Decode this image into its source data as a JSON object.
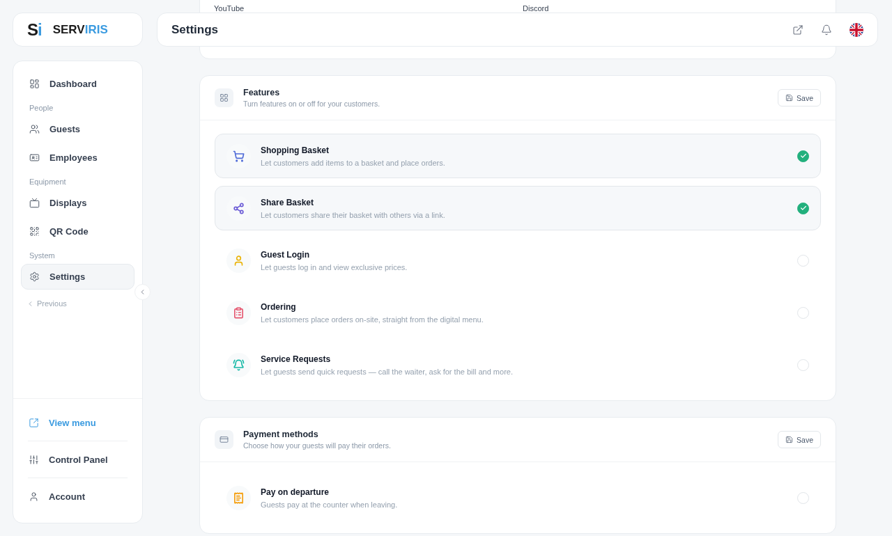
{
  "brand": {
    "mark_dark": "S",
    "mark_light": "i",
    "name_dark": "SERV",
    "name_light": "IRIS"
  },
  "header": {
    "title": "Settings"
  },
  "top_card": {
    "labels": [
      "YouTube",
      "Discord"
    ]
  },
  "sidebar": {
    "items": [
      {
        "kind": "item",
        "label": "Dashboard",
        "selected": false
      },
      {
        "kind": "section",
        "label": "People"
      },
      {
        "kind": "item",
        "label": "Guests",
        "selected": false
      },
      {
        "kind": "item",
        "label": "Employees",
        "selected": false
      },
      {
        "kind": "section",
        "label": "Equipment"
      },
      {
        "kind": "item",
        "label": "Displays",
        "selected": false
      },
      {
        "kind": "item",
        "label": "QR Code",
        "selected": false
      },
      {
        "kind": "section",
        "label": "System"
      },
      {
        "kind": "item",
        "label": "Settings",
        "selected": true
      }
    ],
    "previous": "Previous",
    "footer": [
      {
        "label": "View menu",
        "accent": true
      },
      {
        "label": "Control Panel",
        "accent": false
      },
      {
        "label": "Account",
        "accent": false
      }
    ]
  },
  "sections": [
    {
      "title": "Features",
      "subtitle": "Turn features on or off for your customers.",
      "save": "Save",
      "options": [
        {
          "color": "#4f6bd8",
          "title": "Shopping Basket",
          "description": "Let customers add items to a basket and place orders.",
          "checked": true
        },
        {
          "color": "#6b5bd6",
          "title": "Share Basket",
          "description": "Let customers share their basket with others via a link.",
          "checked": true
        },
        {
          "color": "#eab308",
          "title": "Guest Login",
          "description": "Let guests log in and view exclusive prices.",
          "checked": false
        },
        {
          "color": "#e5566f",
          "title": "Ordering",
          "description": "Let customers place orders on-site, straight from the digital menu.",
          "checked": false
        },
        {
          "color": "#14b8a6",
          "title": "Service Requests",
          "description": "Let guests send quick requests — call the waiter, ask for the bill and more.",
          "checked": false
        }
      ]
    },
    {
      "title": "Payment methods",
      "subtitle": "Choose how your guests will pay their orders.",
      "save": "Save",
      "options": [
        {
          "color": "#f59e0b",
          "title": "Pay on departure",
          "description": "Guests pay at the counter when leaving.",
          "checked": false
        }
      ]
    }
  ]
}
